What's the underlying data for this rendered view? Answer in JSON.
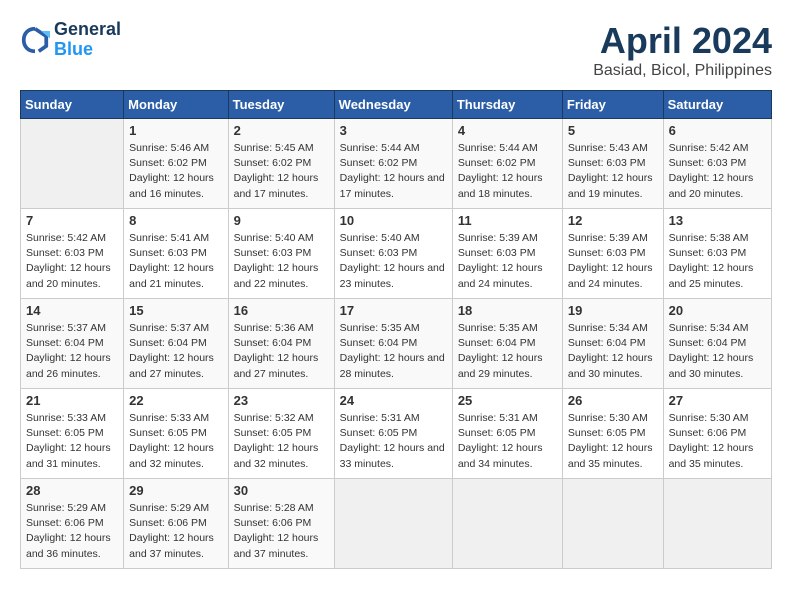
{
  "header": {
    "logo_line1": "General",
    "logo_line2": "Blue",
    "title": "April 2024",
    "subtitle": "Basiad, Bicol, Philippines"
  },
  "calendar": {
    "weekdays": [
      "Sunday",
      "Monday",
      "Tuesday",
      "Wednesday",
      "Thursday",
      "Friday",
      "Saturday"
    ],
    "weeks": [
      [
        {
          "day": "",
          "sunrise": "",
          "sunset": "",
          "daylight": "",
          "empty": true
        },
        {
          "day": "1",
          "sunrise": "Sunrise: 5:46 AM",
          "sunset": "Sunset: 6:02 PM",
          "daylight": "Daylight: 12 hours and 16 minutes.",
          "empty": false
        },
        {
          "day": "2",
          "sunrise": "Sunrise: 5:45 AM",
          "sunset": "Sunset: 6:02 PM",
          "daylight": "Daylight: 12 hours and 17 minutes.",
          "empty": false
        },
        {
          "day": "3",
          "sunrise": "Sunrise: 5:44 AM",
          "sunset": "Sunset: 6:02 PM",
          "daylight": "Daylight: 12 hours and 17 minutes.",
          "empty": false
        },
        {
          "day": "4",
          "sunrise": "Sunrise: 5:44 AM",
          "sunset": "Sunset: 6:02 PM",
          "daylight": "Daylight: 12 hours and 18 minutes.",
          "empty": false
        },
        {
          "day": "5",
          "sunrise": "Sunrise: 5:43 AM",
          "sunset": "Sunset: 6:03 PM",
          "daylight": "Daylight: 12 hours and 19 minutes.",
          "empty": false
        },
        {
          "day": "6",
          "sunrise": "Sunrise: 5:42 AM",
          "sunset": "Sunset: 6:03 PM",
          "daylight": "Daylight: 12 hours and 20 minutes.",
          "empty": false
        }
      ],
      [
        {
          "day": "7",
          "sunrise": "Sunrise: 5:42 AM",
          "sunset": "Sunset: 6:03 PM",
          "daylight": "Daylight: 12 hours and 20 minutes.",
          "empty": false
        },
        {
          "day": "8",
          "sunrise": "Sunrise: 5:41 AM",
          "sunset": "Sunset: 6:03 PM",
          "daylight": "Daylight: 12 hours and 21 minutes.",
          "empty": false
        },
        {
          "day": "9",
          "sunrise": "Sunrise: 5:40 AM",
          "sunset": "Sunset: 6:03 PM",
          "daylight": "Daylight: 12 hours and 22 minutes.",
          "empty": false
        },
        {
          "day": "10",
          "sunrise": "Sunrise: 5:40 AM",
          "sunset": "Sunset: 6:03 PM",
          "daylight": "Daylight: 12 hours and 23 minutes.",
          "empty": false
        },
        {
          "day": "11",
          "sunrise": "Sunrise: 5:39 AM",
          "sunset": "Sunset: 6:03 PM",
          "daylight": "Daylight: 12 hours and 24 minutes.",
          "empty": false
        },
        {
          "day": "12",
          "sunrise": "Sunrise: 5:39 AM",
          "sunset": "Sunset: 6:03 PM",
          "daylight": "Daylight: 12 hours and 24 minutes.",
          "empty": false
        },
        {
          "day": "13",
          "sunrise": "Sunrise: 5:38 AM",
          "sunset": "Sunset: 6:03 PM",
          "daylight": "Daylight: 12 hours and 25 minutes.",
          "empty": false
        }
      ],
      [
        {
          "day": "14",
          "sunrise": "Sunrise: 5:37 AM",
          "sunset": "Sunset: 6:04 PM",
          "daylight": "Daylight: 12 hours and 26 minutes.",
          "empty": false
        },
        {
          "day": "15",
          "sunrise": "Sunrise: 5:37 AM",
          "sunset": "Sunset: 6:04 PM",
          "daylight": "Daylight: 12 hours and 27 minutes.",
          "empty": false
        },
        {
          "day": "16",
          "sunrise": "Sunrise: 5:36 AM",
          "sunset": "Sunset: 6:04 PM",
          "daylight": "Daylight: 12 hours and 27 minutes.",
          "empty": false
        },
        {
          "day": "17",
          "sunrise": "Sunrise: 5:35 AM",
          "sunset": "Sunset: 6:04 PM",
          "daylight": "Daylight: 12 hours and 28 minutes.",
          "empty": false
        },
        {
          "day": "18",
          "sunrise": "Sunrise: 5:35 AM",
          "sunset": "Sunset: 6:04 PM",
          "daylight": "Daylight: 12 hours and 29 minutes.",
          "empty": false
        },
        {
          "day": "19",
          "sunrise": "Sunrise: 5:34 AM",
          "sunset": "Sunset: 6:04 PM",
          "daylight": "Daylight: 12 hours and 30 minutes.",
          "empty": false
        },
        {
          "day": "20",
          "sunrise": "Sunrise: 5:34 AM",
          "sunset": "Sunset: 6:04 PM",
          "daylight": "Daylight: 12 hours and 30 minutes.",
          "empty": false
        }
      ],
      [
        {
          "day": "21",
          "sunrise": "Sunrise: 5:33 AM",
          "sunset": "Sunset: 6:05 PM",
          "daylight": "Daylight: 12 hours and 31 minutes.",
          "empty": false
        },
        {
          "day": "22",
          "sunrise": "Sunrise: 5:33 AM",
          "sunset": "Sunset: 6:05 PM",
          "daylight": "Daylight: 12 hours and 32 minutes.",
          "empty": false
        },
        {
          "day": "23",
          "sunrise": "Sunrise: 5:32 AM",
          "sunset": "Sunset: 6:05 PM",
          "daylight": "Daylight: 12 hours and 32 minutes.",
          "empty": false
        },
        {
          "day": "24",
          "sunrise": "Sunrise: 5:31 AM",
          "sunset": "Sunset: 6:05 PM",
          "daylight": "Daylight: 12 hours and 33 minutes.",
          "empty": false
        },
        {
          "day": "25",
          "sunrise": "Sunrise: 5:31 AM",
          "sunset": "Sunset: 6:05 PM",
          "daylight": "Daylight: 12 hours and 34 minutes.",
          "empty": false
        },
        {
          "day": "26",
          "sunrise": "Sunrise: 5:30 AM",
          "sunset": "Sunset: 6:05 PM",
          "daylight": "Daylight: 12 hours and 35 minutes.",
          "empty": false
        },
        {
          "day": "27",
          "sunrise": "Sunrise: 5:30 AM",
          "sunset": "Sunset: 6:06 PM",
          "daylight": "Daylight: 12 hours and 35 minutes.",
          "empty": false
        }
      ],
      [
        {
          "day": "28",
          "sunrise": "Sunrise: 5:29 AM",
          "sunset": "Sunset: 6:06 PM",
          "daylight": "Daylight: 12 hours and 36 minutes.",
          "empty": false
        },
        {
          "day": "29",
          "sunrise": "Sunrise: 5:29 AM",
          "sunset": "Sunset: 6:06 PM",
          "daylight": "Daylight: 12 hours and 37 minutes.",
          "empty": false
        },
        {
          "day": "30",
          "sunrise": "Sunrise: 5:28 AM",
          "sunset": "Sunset: 6:06 PM",
          "daylight": "Daylight: 12 hours and 37 minutes.",
          "empty": false
        },
        {
          "day": "",
          "sunrise": "",
          "sunset": "",
          "daylight": "",
          "empty": true
        },
        {
          "day": "",
          "sunrise": "",
          "sunset": "",
          "daylight": "",
          "empty": true
        },
        {
          "day": "",
          "sunrise": "",
          "sunset": "",
          "daylight": "",
          "empty": true
        },
        {
          "day": "",
          "sunrise": "",
          "sunset": "",
          "daylight": "",
          "empty": true
        }
      ]
    ]
  }
}
